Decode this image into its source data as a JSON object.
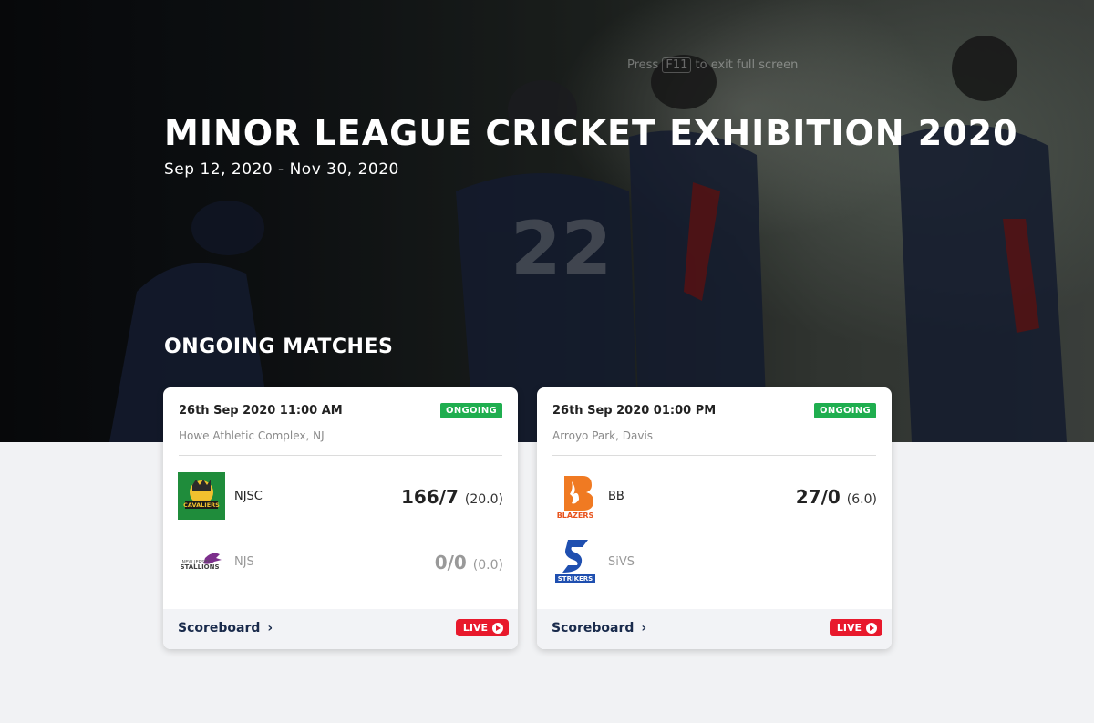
{
  "hero": {
    "fullscreen_hint_prefix": "Press",
    "fullscreen_hint_key": "F11",
    "fullscreen_hint_suffix": "to exit full screen",
    "title": "MINOR LEAGUE CRICKET EXHIBITION 2020",
    "dates": "Sep 12, 2020 - Nov 30, 2020"
  },
  "section_title": "ONGOING MATCHES",
  "matches": [
    {
      "datetime": "26th Sep 2020 11:00 AM",
      "status": "ONGOING",
      "venue": "Howe Athletic Complex, NJ",
      "team1": {
        "name": "NJSC",
        "logo": "cavaliers-logo",
        "score": "166/7",
        "overs": "(20.0)"
      },
      "team2": {
        "name": "NJS",
        "logo": "stallions-logo",
        "score": "0/0",
        "overs": "(0.0)"
      },
      "scoreboard_label": "Scoreboard",
      "live_label": "LIVE"
    },
    {
      "datetime": "26th Sep 2020 01:00 PM",
      "status": "ONGOING",
      "venue": "Arroyo Park, Davis",
      "team1": {
        "name": "BB",
        "logo": "blazers-logo",
        "score": "27/0",
        "overs": "(6.0)"
      },
      "team2": {
        "name": "SiVS",
        "logo": "strikers-logo",
        "score": "",
        "overs": ""
      },
      "scoreboard_label": "Scoreboard",
      "live_label": "LIVE"
    }
  ],
  "colors": {
    "ongoing_badge": "#1fae4f",
    "live_button": "#e8192c",
    "link": "#1a2b4c",
    "page_bg": "#f1f2f4"
  },
  "logo_text": {
    "cavaliers": "CAVALIERS",
    "stallions": "STALLIONS",
    "blazers": "BLAZERS",
    "strikers": "STRIKERS"
  }
}
